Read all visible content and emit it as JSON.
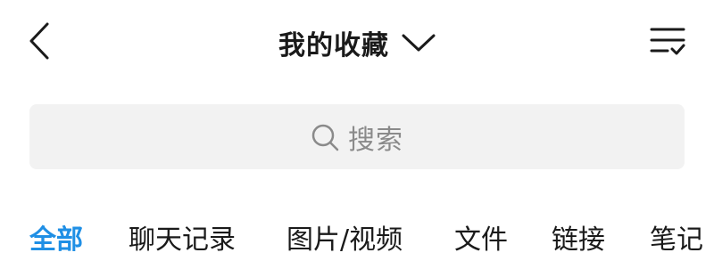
{
  "header": {
    "title": "我的收藏"
  },
  "search": {
    "placeholder": "搜索"
  },
  "tabs": [
    {
      "label": "全部",
      "active": true
    },
    {
      "label": "聊天记录",
      "active": false
    },
    {
      "label": "图片/视频",
      "active": false
    },
    {
      "label": "文件",
      "active": false
    },
    {
      "label": "链接",
      "active": false
    },
    {
      "label": "笔记",
      "active": false
    }
  ],
  "colors": {
    "accent": "#1f8fe5",
    "search_background": "#f2f2f2",
    "placeholder_text": "#8a8a8a"
  },
  "icons": {
    "back": "chevron-left-icon",
    "title_dropdown": "chevron-down-icon",
    "filter": "filter-list-check-icon",
    "search": "search-icon"
  }
}
